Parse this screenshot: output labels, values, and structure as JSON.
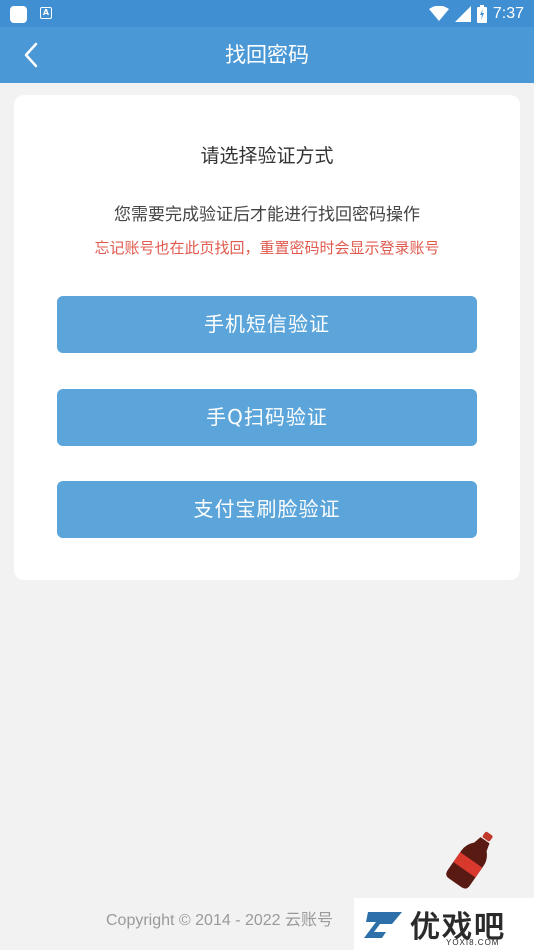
{
  "statusbar": {
    "time": "7:37"
  },
  "appbar": {
    "title": "找回密码"
  },
  "card": {
    "heading": "请选择验证方式",
    "description": "您需要完成验证后才能进行找回密码操作",
    "note": "忘记账号也在此页找回，重置密码时会显示登录账号"
  },
  "methods": [
    {
      "label": "手机短信验证"
    },
    {
      "label": "手Q扫码验证"
    },
    {
      "label": "支付宝刷脸验证"
    }
  ],
  "footer": {
    "copyright": "Copyright © 2014 - 2022 云账号"
  },
  "watermark": {
    "brand": "优戏吧",
    "domain": "YOXI8.COM"
  },
  "colors": {
    "primary": "#4a98d6",
    "button": "#5ba5da",
    "note": "#e05a4e"
  }
}
